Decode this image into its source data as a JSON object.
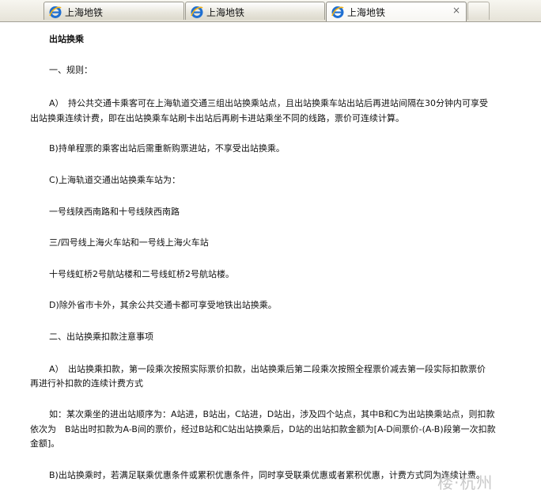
{
  "tabs": [
    {
      "label": "上海地铁",
      "active": false
    },
    {
      "label": "上海地铁",
      "active": false
    },
    {
      "label": "上海地铁",
      "active": true,
      "close": "×"
    }
  ],
  "article": {
    "title": "出站换乘",
    "s1_heading": "一、规则：",
    "a_line1": "A）　持公共交通卡乘客可在上海轨道交通三组出站换乘站点，且出站换乘车站出站后再进站间隔在30分钟内可享受",
    "a_line2": "出站换乘连续计费，即在出站换乘车站刷卡出站后再刷卡进站乘坐不同的线路，票价可连续计算。",
    "b": "B)持单程票的乘客出站后需重新购票进站，不享受出站换乘。",
    "c": "C)上海轨道交通出站换乘车站为：",
    "st1": "一号线陕西南路和十号线陕西南路",
    "st2": "三/四号线上海火车站和一号线上海火车站",
    "st3": "十号线虹桥2号航站楼和二号线虹桥2号航站楼。",
    "d": "D)除外省市卡外，其余公共交通卡都可享受地铁出站换乘。",
    "s2_heading": "二、出站换乘扣款注意事项",
    "a2_line1": "A）　出站换乘扣款，第一段乘次按照实际票价扣款，出站换乘后第二段乘次按照全程票价减去第一段实际扣款票价",
    "a2_line2": "再进行补扣款的连续计费方式",
    "ex_line1": "如：某次乘坐的进出站顺序为：A站进，B站出，C站进，D站出，涉及四个站点，其中B和C为出站换乘站点，则扣款",
    "ex_line2": "依次为　B站出时扣款为A-B间的票价，经过B站和C站出站换乘后，D站的出站扣款金额为[A-D间票价-(A-B)段第一次扣款",
    "ex_line3": "金额]。",
    "b2": "B)出站换乘时，若满足联乘优惠条件或累积优惠条件，同时享受联乘优惠或者累积优惠，计费方式同为连续计费。"
  },
  "watermark": "楼·杭州",
  "colors": {
    "tab_border": "#9c9a8f",
    "tab_bg": "#e8e6dc",
    "ie_blue": "#1f6fd1",
    "ie_gold": "#f2b31b"
  },
  "icons": [
    "ie-icon",
    "close-icon"
  ]
}
